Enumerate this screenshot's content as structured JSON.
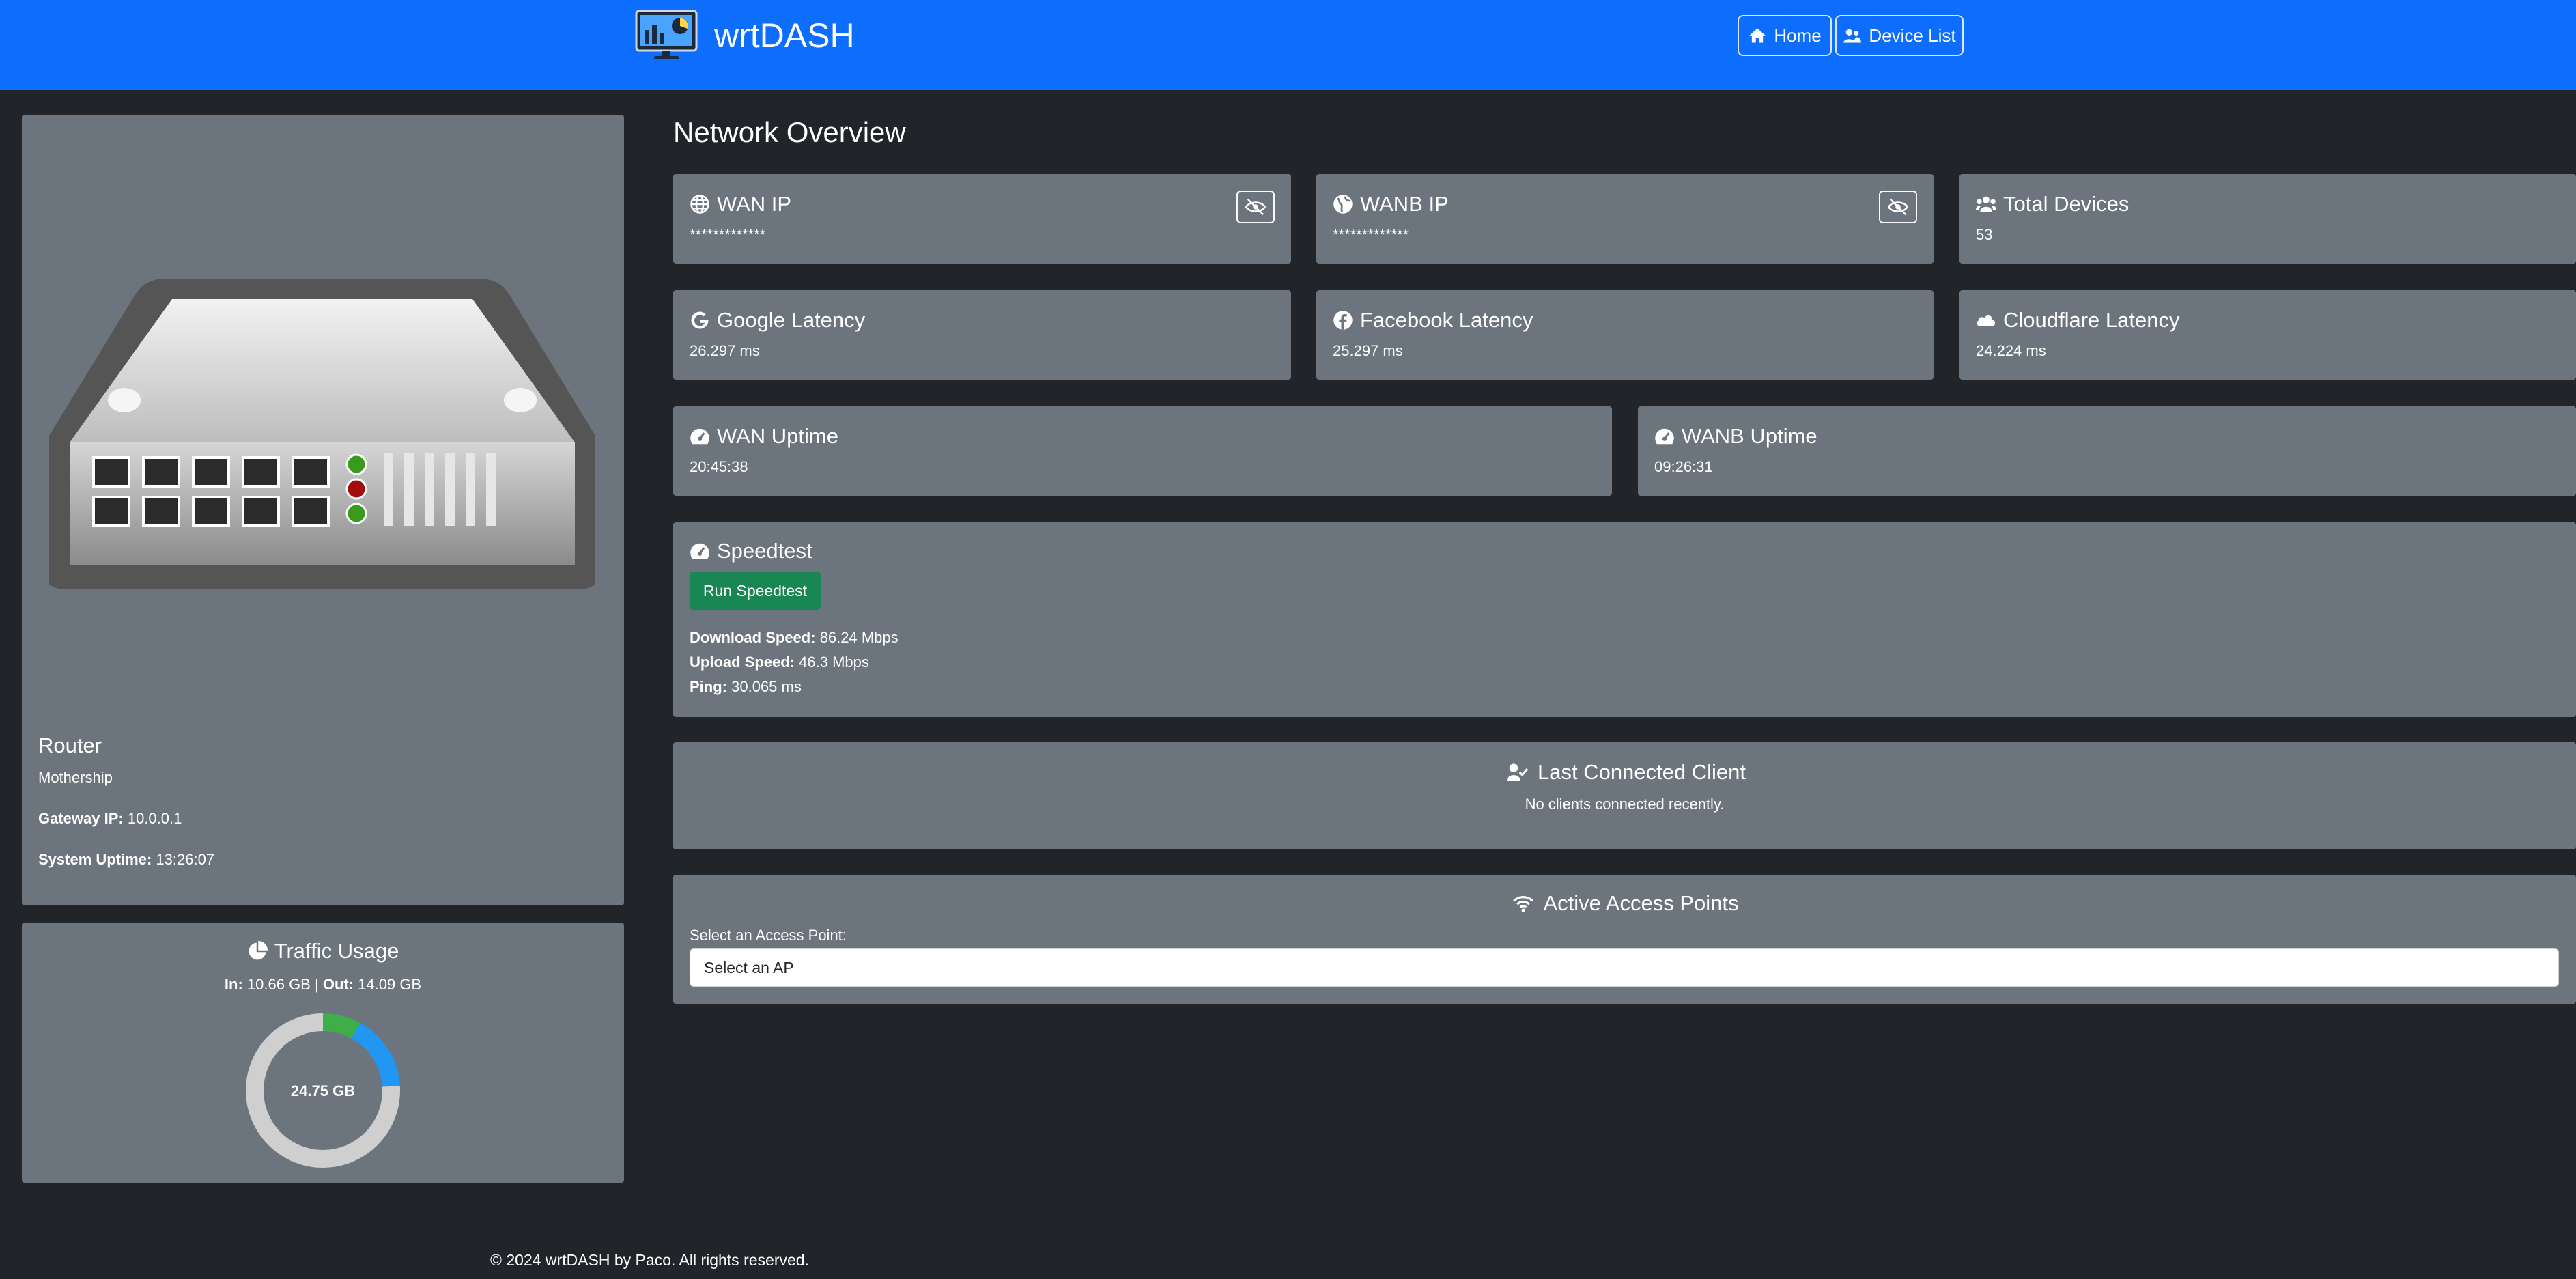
{
  "app": {
    "brand": "wrtDASH"
  },
  "nav": {
    "home_label": "Home",
    "devices_label": "Device List"
  },
  "router": {
    "title": "Router",
    "name": "Mothership",
    "gateway_label": "Gateway IP:",
    "gateway_value": "10.0.0.1",
    "uptime_label": "System Uptime:",
    "uptime_value": "13:26:07"
  },
  "traffic": {
    "title": "Traffic Usage",
    "in_label": "In:",
    "in_value": "10.66 GB",
    "separator": "|",
    "out_label": "Out:",
    "out_value": "14.09 GB",
    "total": "24.75 GB",
    "segments": [
      {
        "label": "green",
        "fraction": 0.08,
        "color": "#3fae49"
      },
      {
        "label": "blue",
        "fraction": 0.16,
        "color": "#2196f3"
      },
      {
        "label": "rest",
        "fraction": 0.76,
        "color": "#cfcfcf"
      }
    ]
  },
  "overview": {
    "heading": "Network Overview",
    "wan_ip": {
      "title": "WAN IP",
      "value": "*************"
    },
    "wanb_ip": {
      "title": "WANB IP",
      "value": "*************"
    },
    "total_devices": {
      "title": "Total Devices",
      "value": "53"
    },
    "google": {
      "title": "Google Latency",
      "value": "26.297 ms"
    },
    "facebook": {
      "title": "Facebook Latency",
      "value": "25.297 ms"
    },
    "cloudflare": {
      "title": "Cloudflare Latency",
      "value": "24.224 ms"
    },
    "wan_uptime": {
      "title": "WAN Uptime",
      "value": "20:45:38"
    },
    "wanb_uptime": {
      "title": "WANB Uptime",
      "value": "09:26:31"
    }
  },
  "speedtest": {
    "title": "Speedtest",
    "button": "Run Speedtest",
    "download_label": "Download Speed:",
    "download_value": "86.24 Mbps",
    "upload_label": "Upload Speed:",
    "upload_value": "46.3 Mbps",
    "ping_label": "Ping:",
    "ping_value": "30.065 ms"
  },
  "last_client": {
    "title": "Last Connected Client",
    "message": "No clients connected recently."
  },
  "access_points": {
    "title": "Active Access Points",
    "label": "Select an Access Point:",
    "selected": "Select an AP"
  },
  "footer": {
    "text": "© 2024 wrtDASH by Paco. All rights reserved."
  },
  "icons": {
    "logo": "monitor-chart-icon",
    "home": "home-icon",
    "devices": "users-icon",
    "globe": "globe-icon",
    "eye": "eye-slash-icon",
    "google": "google-icon",
    "facebook": "facebook-icon",
    "cloud": "cloud-icon",
    "gauge": "gauge-icon",
    "user_check": "user-check-icon",
    "wifi": "wifi-icon",
    "pie": "pie-chart-icon"
  }
}
